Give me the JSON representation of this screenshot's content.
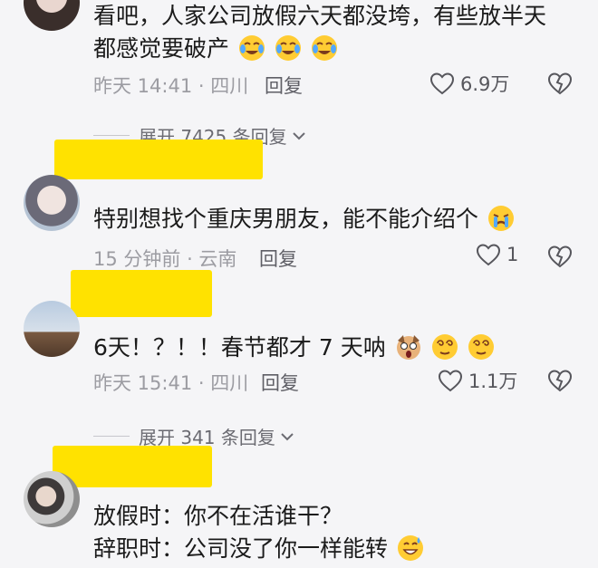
{
  "comments": [
    {
      "text_line1": "看吧，人家公司放假六天都没垮，有些放半天",
      "text_line2": "都感觉要破产",
      "time_location": "昨天 14:41 · 四川",
      "reply_label": "回复",
      "like_count": "6.9万",
      "expand_label": "展开 7425 条回复"
    },
    {
      "text_line1": "特别想找个重庆男朋友，能不能介绍个",
      "time_location": "15 分钟前 · 云南",
      "reply_label": "回复",
      "like_count": "1"
    },
    {
      "text_line1": "6天！？！！春节都才 7 天呐",
      "time_location": "昨天 15:41 · 四川",
      "reply_label": "回复",
      "like_count": "1.1万",
      "expand_label": "展开 341 条回复"
    },
    {
      "text_line1": "放假时：你不在活谁干？",
      "text_line2": "辞职时：公司没了你一样能转"
    }
  ],
  "icons": {
    "like": "heart-outline-icon",
    "dislike": "broken-heart-icon",
    "expand": "chevron-down-icon",
    "emoji_laugh_cry": "laughing-tears-emoji",
    "emoji_cry": "crying-emoji",
    "emoji_shock": "shocked-dog-emoji",
    "emoji_dizzy": "dizzy-face-emoji",
    "emoji_sweat": "grinning-sweat-emoji"
  },
  "colors": {
    "redaction": "#ffe200",
    "background": "#f5f5f7"
  }
}
